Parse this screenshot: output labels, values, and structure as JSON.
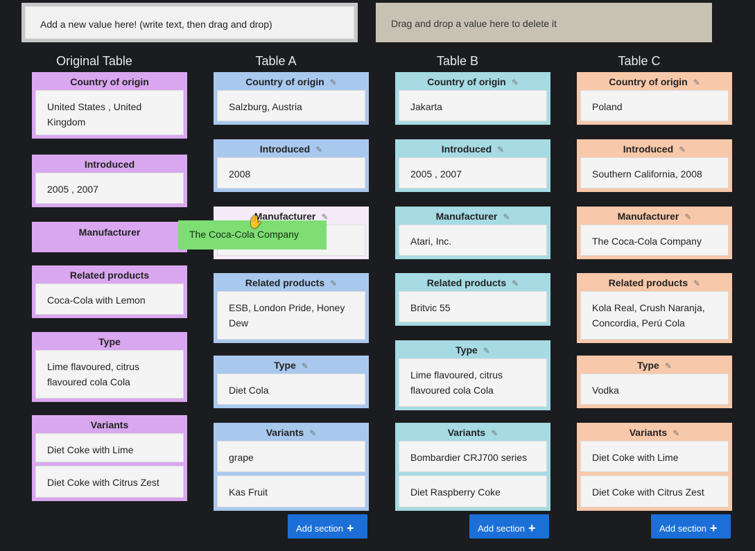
{
  "add_zone": {
    "text": "Add a new value here! (write text, then drag and drop)"
  },
  "delete_zone": {
    "text": "Drag and drop a value here to delete it"
  },
  "drag_ghost": {
    "text": "The Coca-Cola Company"
  },
  "add_section": {
    "label": "Add section"
  },
  "colors": {
    "original": "#d9a7ef",
    "table_a": "#a9c8ee",
    "table_b": "#a6dbe3",
    "table_c": "#f8c8aa",
    "button": "#1b6fd6",
    "drag_ghost": "#7ede73"
  },
  "tables": {
    "original": {
      "title": "Original Table",
      "sections": [
        {
          "header": "Country of origin",
          "values": [
            "United States , United Kingdom"
          ]
        },
        {
          "header": "Introduced",
          "values": [
            "2005 , 2007"
          ]
        },
        {
          "header": "Manufacturer",
          "values": []
        },
        {
          "header": "Related products",
          "values": [
            "Coca-Cola with Lemon"
          ]
        },
        {
          "header": "Type",
          "values": [
            "Lime flavoured, citrus flavoured cola Cola"
          ]
        },
        {
          "header": "Variants",
          "values": [
            "Diet Coke with Lime",
            "Diet Coke with Citrus Zest"
          ]
        }
      ]
    },
    "a": {
      "title": "Table A",
      "sections": [
        {
          "header": "Country of origin",
          "values": [
            "Salzburg, Austria"
          ]
        },
        {
          "header": "Introduced",
          "values": [
            "2008"
          ]
        },
        {
          "header": "Manufacturer",
          "values": [
            "Hood River Distillers"
          ]
        },
        {
          "header": "Related products",
          "values": [
            "ESB, London Pride, Honey Dew"
          ]
        },
        {
          "header": "Type",
          "values": [
            "Diet Cola"
          ]
        },
        {
          "header": "Variants",
          "values": [
            "grape",
            "Kas Fruit"
          ]
        }
      ]
    },
    "b": {
      "title": "Table B",
      "sections": [
        {
          "header": "Country of origin",
          "values": [
            "Jakarta"
          ]
        },
        {
          "header": "Introduced",
          "values": [
            "2005 , 2007"
          ]
        },
        {
          "header": "Manufacturer",
          "values": [
            "Atari, Inc."
          ]
        },
        {
          "header": "Related products",
          "values": [
            "Britvic 55"
          ]
        },
        {
          "header": "Type",
          "values": [
            "Lime flavoured, citrus flavoured cola Cola"
          ]
        },
        {
          "header": "Variants",
          "values": [
            "Bombardier CRJ700 series",
            "Diet Raspberry Coke"
          ]
        }
      ]
    },
    "c": {
      "title": "Table C",
      "sections": [
        {
          "header": "Country of origin",
          "values": [
            "Poland"
          ]
        },
        {
          "header": "Introduced",
          "values": [
            "Southern California, 2008"
          ]
        },
        {
          "header": "Manufacturer",
          "values": [
            "The Coca-Cola Company"
          ]
        },
        {
          "header": "Related products",
          "values": [
            "Kola Real, Crush Naranja, Concordia, Perú Cola"
          ]
        },
        {
          "header": "Type",
          "values": [
            "Vodka"
          ]
        },
        {
          "header": "Variants",
          "values": [
            "Diet Coke with Lime",
            "Diet Coke with Citrus Zest"
          ]
        }
      ]
    }
  }
}
